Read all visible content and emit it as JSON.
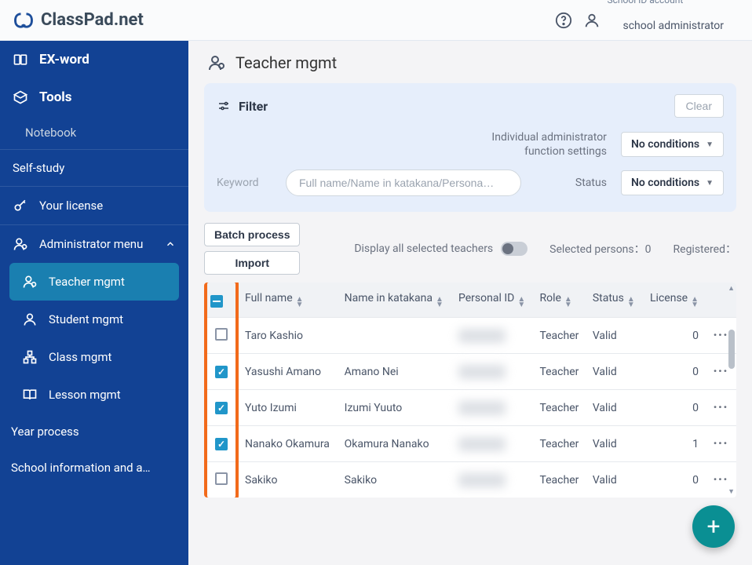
{
  "header": {
    "logo_text": "ClassPad.net",
    "account_sub": "School ID account",
    "account_main": "school administrator"
  },
  "sidebar": {
    "exword": "EX-word",
    "tools": "Tools",
    "notebook": "Notebook",
    "selfstudy": "Self-study",
    "license": "Your license",
    "admin_menu": "Administrator menu",
    "teacher_mgmt": "Teacher mgmt",
    "student_mgmt": "Student mgmt",
    "class_mgmt": "Class mgmt",
    "lesson_mgmt": "Lesson mgmt",
    "year_process": "Year process",
    "school_info": "School information and a…"
  },
  "page": {
    "title": "Teacher mgmt"
  },
  "filter": {
    "title": "Filter",
    "clear": "Clear",
    "admin_settings_label": "Individual administrator\nfunction settings",
    "dropdown_value": "No conditions",
    "keyword_label": "Keyword",
    "keyword_placeholder": "Full name/Name in katakana/Persona…",
    "status_label": "Status"
  },
  "toolbar": {
    "batch": "Batch process",
    "import": "Import",
    "display_all": "Display all selected teachers",
    "selected": "Selected persons：0",
    "registered": "Registered："
  },
  "columns": {
    "full_name": "Full name",
    "katakana": "Name in katakana",
    "personal_id": "Personal ID",
    "role": "Role",
    "status": "Status",
    "license": "License"
  },
  "rows": [
    {
      "checked": false,
      "full_name": "Taro Kashio",
      "katakana": "",
      "role": "Teacher",
      "status": "Valid",
      "license": "0"
    },
    {
      "checked": true,
      "full_name": "Yasushi Amano",
      "katakana": "Amano Nei",
      "role": "Teacher",
      "status": "Valid",
      "license": "0"
    },
    {
      "checked": true,
      "full_name": "Yuto Izumi",
      "katakana": "Izumi Yuuto",
      "role": "Teacher",
      "status": "Valid",
      "license": "0"
    },
    {
      "checked": true,
      "full_name": "Nanako Okamura",
      "katakana": "Okamura Nanako",
      "role": "Teacher",
      "status": "Valid",
      "license": "1"
    },
    {
      "checked": false,
      "full_name": "Sakiko",
      "katakana": "Sakiko",
      "role": "Teacher",
      "status": "Valid",
      "license": "0"
    }
  ]
}
